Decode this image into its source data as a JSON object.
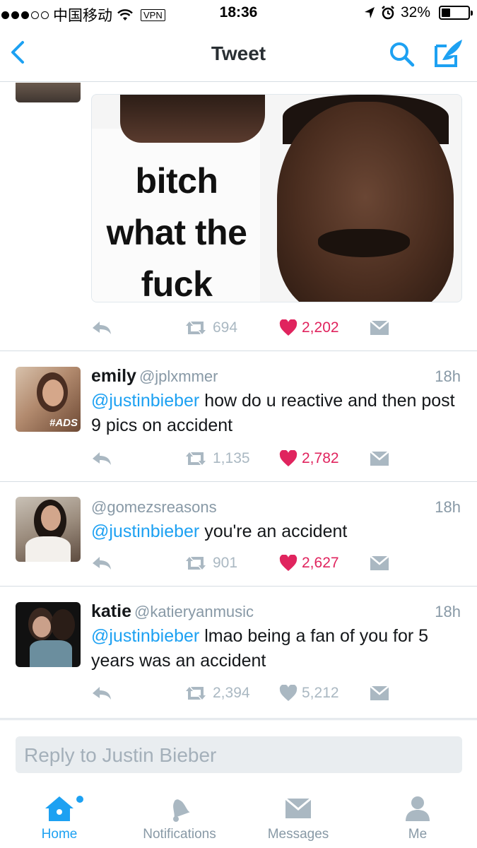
{
  "status_bar": {
    "carrier": "中国移动",
    "vpn": "VPN",
    "time": "18:36",
    "battery": "32%",
    "battery_level": 0.32
  },
  "nav": {
    "title": "Tweet"
  },
  "main_tweet": {
    "image_text": "bitch what the fuck",
    "retweets": "694",
    "likes": "2,202"
  },
  "replies": [
    {
      "name": "emily",
      "handle": "@jplxmmer",
      "time": "18h",
      "mention": "@justinbieber",
      "text": " how do u reactive and then post 9 pics on accident",
      "retweets": "1,135",
      "likes": "2,782",
      "liked": true,
      "avatar_text": "#ADS"
    },
    {
      "name": "",
      "handle": "@gomezsreasons",
      "time": "18h",
      "mention": "@justinbieber",
      "text": " you're an accident",
      "retweets": "901",
      "likes": "2,627",
      "liked": true
    },
    {
      "name": "katie",
      "handle": "@katieryanmusic",
      "time": "18h",
      "mention": "@justinbieber",
      "text": " lmao being a fan of you for 5 years was an accident",
      "retweets": "2,394",
      "likes": "5,212",
      "liked": false
    }
  ],
  "reply_box": {
    "placeholder": "Reply to Justin Bieber"
  },
  "tabs": [
    {
      "label": "Home",
      "icon": "home-icon",
      "active": true
    },
    {
      "label": "Notifications",
      "icon": "bell-icon",
      "active": false
    },
    {
      "label": "Messages",
      "icon": "envelope-icon",
      "active": false
    },
    {
      "label": "Me",
      "icon": "person-icon",
      "active": false
    }
  ],
  "colors": {
    "accent": "#1da1f2",
    "like": "#e0245e",
    "muted": "#aab8c2"
  }
}
